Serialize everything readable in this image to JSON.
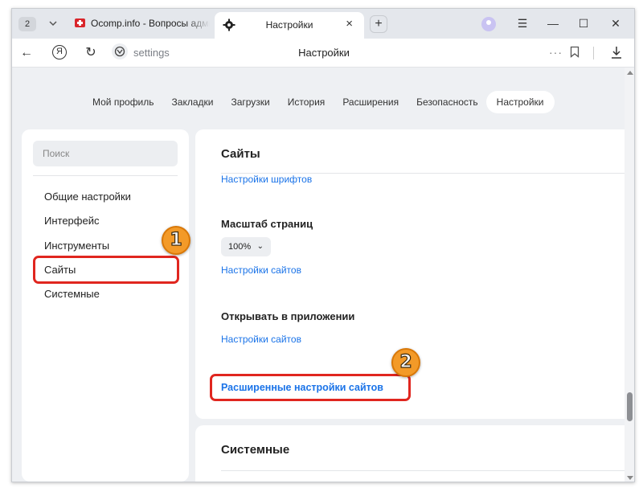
{
  "tabs": {
    "count": "2",
    "inactive_title": "Ocomp.info - Вопросы админу",
    "active_title": "Настройки",
    "close_glyph": "×",
    "new_tab_glyph": "+"
  },
  "window_controls": {
    "menu": "☰",
    "minimize": "—",
    "maximize": "☐",
    "close": "✕"
  },
  "address_bar": {
    "back": "←",
    "reload": "↻",
    "yandex": "Я",
    "url": "settings",
    "page_title": "Настройки",
    "more": "···"
  },
  "top_nav": [
    "Мой профиль",
    "Закладки",
    "Загрузки",
    "История",
    "Расширения",
    "Безопасность",
    "Настройки"
  ],
  "top_nav_active": "Настройки",
  "sidebar": {
    "search_placeholder": "Поиск",
    "items": [
      "Общие настройки",
      "Интерфейс",
      "Инструменты",
      "Сайты",
      "Системные"
    ]
  },
  "main": {
    "section_sites": "Сайты",
    "font_settings_link": "Настройки шрифтов",
    "page_scale_label": "Масштаб страниц",
    "zoom_value": "100%",
    "sites_settings_link_1": "Настройки сайтов",
    "open_in_app_label": "Открывать в приложении",
    "sites_settings_link_2": "Настройки сайтов",
    "advanced_sites_link": "Расширенные настройки сайтов",
    "section_system": "Системные"
  },
  "annotations": {
    "step1": "1",
    "step2": "2",
    "highlight_color": "#e0261f",
    "badge_color": "#f39a28"
  },
  "colors": {
    "link": "#1a73e8",
    "page_bg": "#eef0f3"
  }
}
